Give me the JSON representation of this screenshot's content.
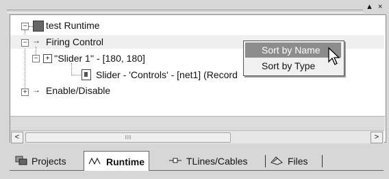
{
  "window": {
    "controls": "▲ ×"
  },
  "tree": {
    "root_label": "test Runtime",
    "firing_control": "Firing Control",
    "slider_node": "''Slider 1'' - [180, 180]",
    "slider_detail": "Slider - 'Controls' - [net1]  (Record",
    "enable_disable": "Enable/Disable"
  },
  "context_menu": {
    "items": [
      {
        "label": "Sort by Name",
        "selected": true
      },
      {
        "label": "Sort by Type",
        "selected": false
      }
    ]
  },
  "scrollbar": {
    "left_arrow": "<",
    "right_arrow": ">",
    "thumb_grip": "IIII"
  },
  "tabs": [
    {
      "label": "Projects",
      "icon": "projects-icon",
      "active": false
    },
    {
      "label": "Runtime",
      "icon": "runtime-wave-icon",
      "active": true
    },
    {
      "label": "TLines/Cables",
      "icon": "tline-icon",
      "active": false
    },
    {
      "label": "Files",
      "icon": "files-icon",
      "active": false
    }
  ],
  "colors": {
    "menu_highlight": "#8c8c8c",
    "panel_bg": "#ffffff",
    "chrome_bg": "#d7d7d7"
  }
}
